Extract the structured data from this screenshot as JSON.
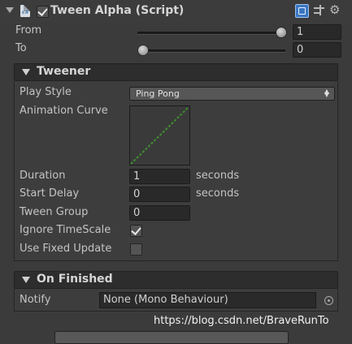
{
  "component": {
    "title": "Tween Alpha (Script)",
    "enabled": true,
    "icons": [
      "script-icon",
      "help-book-icon",
      "presets-icon",
      "gear-icon"
    ]
  },
  "properties": {
    "from_label": "From",
    "from_value": "1",
    "from_slider_fraction": 1,
    "to_label": "To",
    "to_value": "0",
    "to_slider_fraction": 0
  },
  "tweener": {
    "header": "Tweener",
    "play_style_label": "Play Style",
    "play_style_value": "Ping Pong",
    "animation_curve_label": "Animation Curve",
    "duration_label": "Duration",
    "duration_value": "1",
    "duration_unit": "seconds",
    "start_delay_label": "Start Delay",
    "start_delay_value": "0",
    "start_delay_unit": "seconds",
    "tween_group_label": "Tween Group",
    "tween_group_value": "0",
    "ignore_timescale_label": "Ignore TimeScale",
    "ignore_timescale_checked": true,
    "use_fixed_update_label": "Use Fixed Update",
    "use_fixed_update_checked": false
  },
  "on_finished": {
    "header": "On Finished",
    "notify_label": "Notify",
    "notify_value": "None (Mono Behaviour)"
  },
  "watermark": "https://blog.csdn.net/BraveRunTo",
  "colors": {
    "panel_bg": "#3b3b3b",
    "field_bg": "#292929",
    "section_header_bg": "#2d2d2d",
    "curve_line": "#3f8f2f",
    "help_icon": "#3a76c2"
  }
}
